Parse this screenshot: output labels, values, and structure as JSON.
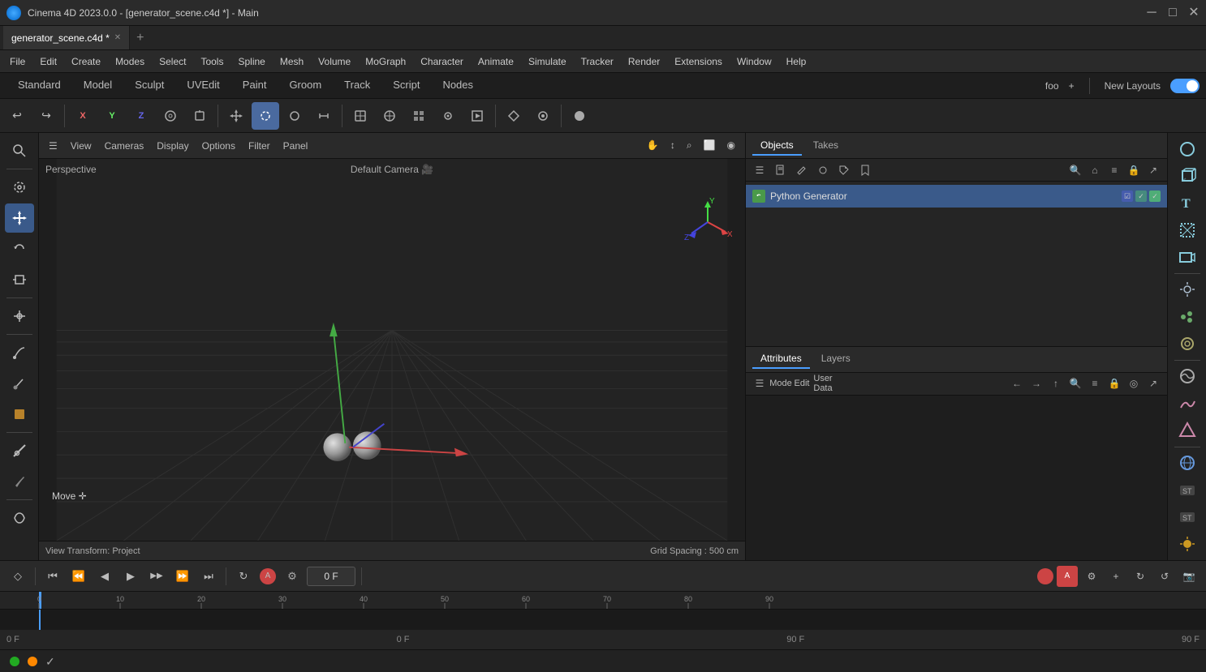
{
  "window": {
    "title": "Cinema 4D 2023.0.0 - [generator_scene.c4d *] - Main",
    "app_icon": "cinema4d-icon",
    "controls": {
      "minimize": "─",
      "maximize": "□",
      "close": "✕"
    }
  },
  "tabs": {
    "items": [
      {
        "label": "generator_scene.c4d *",
        "active": true
      },
      {
        "label": "+",
        "is_add": true
      }
    ]
  },
  "menubar": {
    "items": [
      "File",
      "Edit",
      "Create",
      "Modes",
      "Select",
      "Tools",
      "Spline",
      "Mesh",
      "Volume",
      "MoGraph",
      "Character",
      "Animate",
      "Simulate",
      "Tracker",
      "Render",
      "Extensions",
      "Window",
      "Help"
    ]
  },
  "toolbar_tabs": {
    "items": [
      "Standard",
      "Model",
      "Sculpt",
      "UVEdit",
      "Paint",
      "Groom",
      "Track",
      "Script",
      "Nodes"
    ],
    "active": "Standard",
    "right": {
      "foo_label": "foo",
      "add_icon": "+",
      "new_layouts_label": "New Layouts",
      "toggle": true
    }
  },
  "tool_row": {
    "groups": [
      [
        "undo-icon",
        "redo-icon"
      ],
      [
        "x-axis",
        "y-axis",
        "z-axis",
        "all-axes",
        "rotate-coord"
      ],
      [
        "select-object",
        "move-tool",
        "rotate-tool",
        "scale-tool",
        "snap-tool"
      ],
      [
        "transform-icon",
        "coordinate-icon",
        "grid-icon",
        "screen-icon",
        "back-face-icon"
      ],
      [
        "deform-icon",
        "pivot-icon",
        "snap-settings",
        "render-settings"
      ],
      [
        "axis-center",
        "display-mode"
      ]
    ]
  },
  "viewport": {
    "label": "Perspective",
    "camera": "Default Camera",
    "toolbar": {
      "items": [
        "View",
        "Cameras",
        "Display",
        "Options",
        "Filter",
        "Panel"
      ]
    },
    "gizmo": {
      "move_label": "Move ✛"
    },
    "status": {
      "transform": "View Transform: Project",
      "grid_spacing": "Grid Spacing : 500 cm"
    },
    "axis": {
      "x_label": "X",
      "y_label": "Y",
      "z_label": "Z"
    }
  },
  "objects_panel": {
    "tabs": [
      "Objects",
      "Takes"
    ],
    "active_tab": "Objects",
    "toolbar_icons": [
      "menu",
      "file",
      "edit",
      "object",
      "tags",
      "bookmarks",
      "search",
      "home",
      "list",
      "lock",
      "export"
    ],
    "items": [
      {
        "name": "Python Generator",
        "icon_color": "#4a9a4a",
        "tags": [
          "checkbox",
          "check",
          "visibility"
        ]
      }
    ]
  },
  "right_sidebar": {
    "icons": [
      "sphere-icon",
      "cube-icon",
      "text-icon",
      "null-icon",
      "camera-icon",
      "light-icon",
      "mograph-icon",
      "deformer-icon",
      "scene-icon",
      "spline-generator-icon",
      "sketch-icon",
      "globe-icon",
      "tag-icon",
      "sun-icon"
    ]
  },
  "attributes_panel": {
    "tabs": [
      "Attributes",
      "Layers"
    ],
    "active_tab": "Attributes",
    "toolbar": {
      "mode_label": "Mode",
      "edit_label": "Edit",
      "user_data_label": "User Data",
      "nav_icons": [
        "back",
        "forward",
        "up",
        "search",
        "list",
        "lock",
        "target",
        "export"
      ]
    }
  },
  "timeline": {
    "controls": {
      "keyframe_icon": "◇",
      "go_start": "⏮",
      "prev_key": "⏪",
      "prev_frame": "◀",
      "play": "▶",
      "next_frame": "▶▶",
      "next_key": "⏩",
      "go_end": "⏭",
      "loop_icon": "↻",
      "record_icon": "⏺",
      "frame_current": "0 F"
    },
    "icons_right": [
      "record-red",
      "record-badge",
      "settings",
      "plus",
      "cycle",
      "cycle2",
      "screenshot"
    ],
    "ruler": {
      "marks": [
        0,
        10,
        20,
        30,
        40,
        50,
        60,
        70,
        80,
        90
      ]
    },
    "labels": {
      "start": "0 F",
      "start2": "0 F",
      "end": "90 F",
      "end2": "90 F"
    }
  },
  "status_bar": {
    "dot_green": true,
    "dot_orange": true,
    "check_icon": "✓"
  }
}
